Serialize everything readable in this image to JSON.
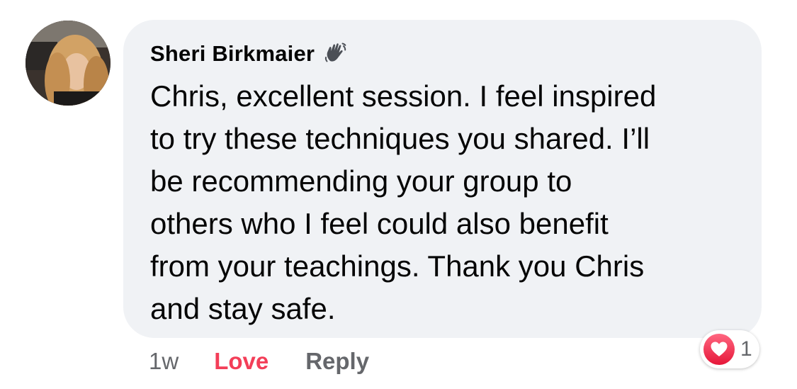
{
  "comment": {
    "author": "Sheri Birkmaier",
    "author_badge_icon": "wave-hand-icon",
    "text": "Chris, excellent session. I feel inspired\nto try these techniques you shared. I’ll\nbe recommending your group to\nothers who I feel could also benefit\nfrom your teachings. Thank you Chris\nand stay safe.",
    "bubble_color": "#f0f2f5"
  },
  "actions": {
    "timestamp": "1w",
    "love_label": "Love",
    "reply_label": "Reply",
    "love_color": "#f33e58",
    "muted_color": "#65676b"
  },
  "reactions": {
    "icon": "heart-icon",
    "count": "1"
  }
}
